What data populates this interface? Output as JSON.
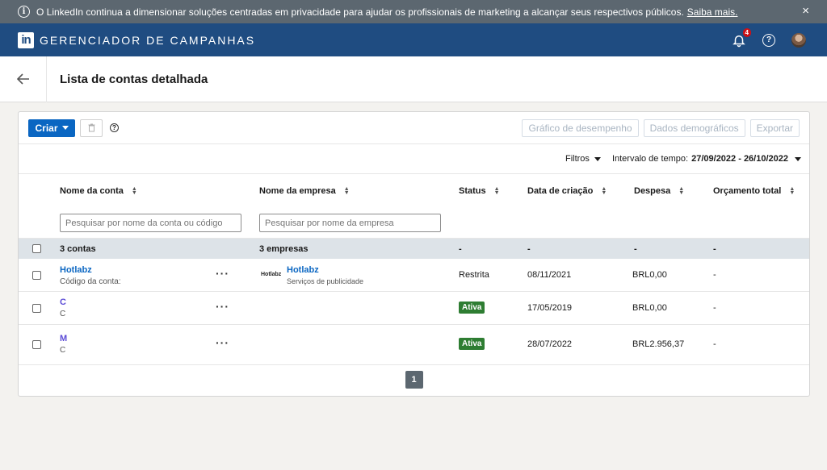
{
  "banner": {
    "message": "O LinkedIn continua a dimensionar soluções centradas em privacidade para ajudar os profissionais de marketing a alcançar seus respectivos públicos.",
    "link": "Saiba mais.",
    "close": "×"
  },
  "header": {
    "logo": "in",
    "title": "GERENCIADOR DE CAMPANHAS",
    "notifications_count": "4"
  },
  "page": {
    "title": "Lista de contas detalhada"
  },
  "toolbar": {
    "create_label": "Criar",
    "performance_chart": "Gráfico de desempenho",
    "demographics": "Dados demográficos",
    "export": "Exportar"
  },
  "filters": {
    "filters_label": "Filtros",
    "range_label": "Intervalo de tempo:",
    "range_value": "27/09/2022 - 26/10/2022"
  },
  "table": {
    "columns": {
      "account_name": "Nome da conta",
      "company_name": "Nome da empresa",
      "status": "Status",
      "created": "Data de criação",
      "spend": "Despesa",
      "budget": "Orçamento total"
    },
    "search_account_placeholder": "Pesquisar por nome da conta ou código",
    "search_company_placeholder": "Pesquisar por nome da empresa",
    "summary": {
      "accounts": "3 contas",
      "companies": "3 empresas",
      "status": "-",
      "created": "-",
      "spend": "-",
      "budget": "-"
    },
    "rows": [
      {
        "account": "Hotlabz",
        "account_sub": "Código da conta:",
        "company_logo": "Hotlabz",
        "company": "Hotlabz",
        "company_sub": "Serviços de publicidade",
        "status": "Restrita",
        "created": "08/11/2021",
        "spend": "BRL0,00",
        "budget": "-"
      },
      {
        "account": "C",
        "account_sub": "C",
        "status": "Ativa",
        "created": "17/05/2019",
        "spend": "BRL0,00",
        "budget": "-"
      },
      {
        "account": "M",
        "account_sub": "C",
        "status": "Ativa",
        "created": "28/07/2022",
        "spend": "BRL2.956,37",
        "budget": "-"
      }
    ]
  },
  "pagination": {
    "current": "1"
  }
}
